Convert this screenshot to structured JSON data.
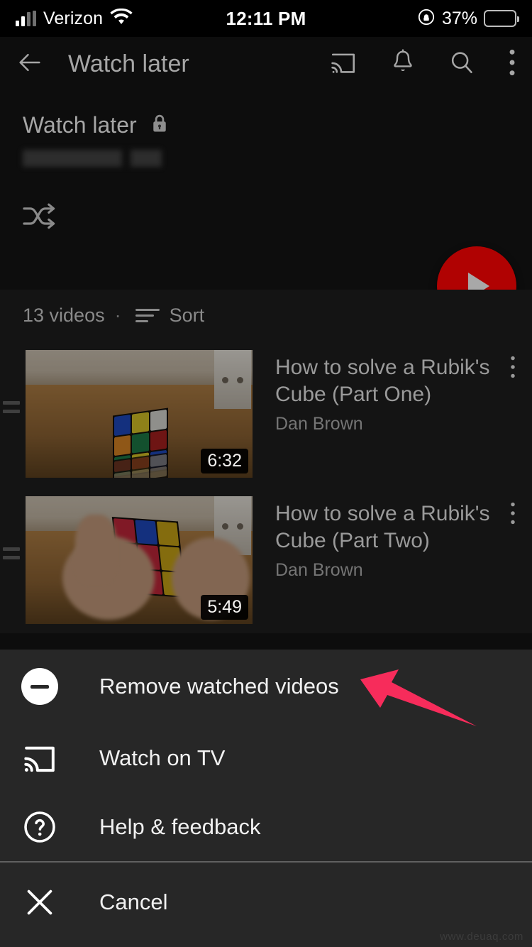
{
  "status_bar": {
    "carrier": "Verizon",
    "time": "12:11 PM",
    "battery_percent": "37%",
    "signal_icon": "signal-bars-icon",
    "wifi_icon": "wifi-icon",
    "rotation_lock_icon": "rotation-lock-icon",
    "battery_icon": "battery-icon",
    "battery_fill_color": "#ffd60a"
  },
  "app_bar": {
    "back_label": "back-arrow",
    "title": "Watch later",
    "cast_icon": "cast-icon",
    "bell_icon": "notifications-bell-icon",
    "search_icon": "search-icon",
    "overflow_icon": "more-vertical-icon"
  },
  "playlist_header": {
    "title": "Watch later",
    "privacy_icon": "lock-icon",
    "owner_redacted": "",
    "shuffle_icon": "shuffle-icon",
    "play_button_label": "play-icon",
    "play_button_color": "#b00202"
  },
  "list_meta": {
    "count": "13 videos",
    "separator": "·",
    "sort_icon": "sort-icon",
    "sort_label": "Sort"
  },
  "videos": [
    {
      "title": "How to solve a Rubik's Cube (Part One)",
      "channel": "Dan Brown",
      "duration": "6:32",
      "drag_handle": "drag-handle-icon",
      "menu_icon": "more-vertical-icon"
    },
    {
      "title": "How to solve a Rubik's Cube (Part Two)",
      "channel": "Dan Brown",
      "duration": "5:49",
      "drag_handle": "drag-handle-icon",
      "menu_icon": "more-vertical-icon"
    }
  ],
  "bottom_sheet": {
    "items": [
      {
        "label": "Remove watched videos",
        "icon": "minus-circle-icon"
      },
      {
        "label": "Watch on TV",
        "icon": "cast-icon"
      },
      {
        "label": "Help & feedback",
        "icon": "help-circle-icon"
      },
      {
        "label": "Cancel",
        "icon": "close-x-icon"
      }
    ]
  },
  "annotation": {
    "arrow_icon": "pointer-arrow-icon",
    "arrow_color": "#f72c5b",
    "points_at": "Remove watched videos"
  },
  "watermark": {
    "text": "www.deuaq.com"
  }
}
